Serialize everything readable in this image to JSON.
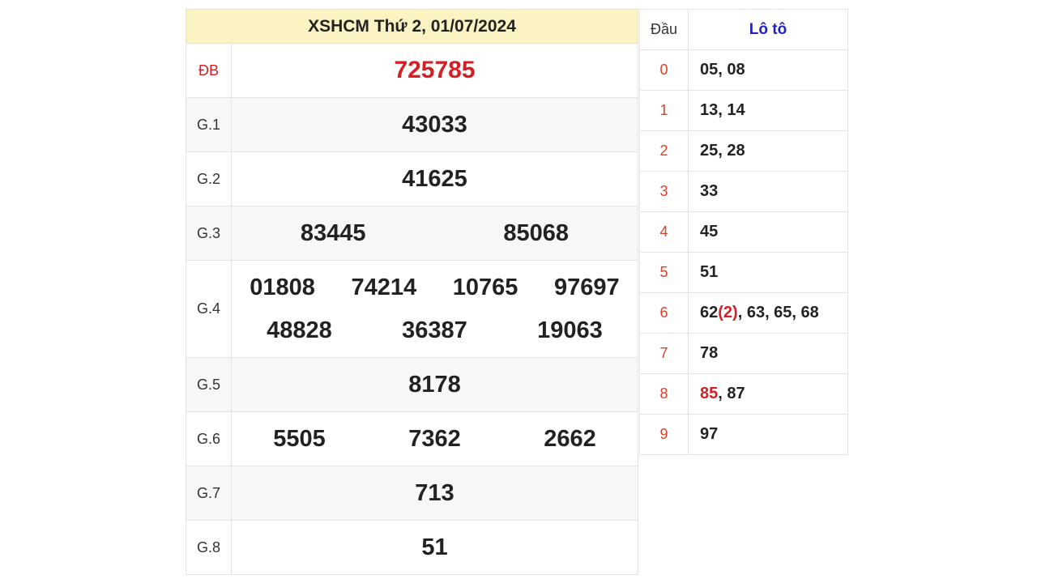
{
  "results": {
    "title": "XSHCM Thứ 2, 01/07/2024",
    "accent_color": "#d32027",
    "header_bg": "#fcf3c2",
    "prizes": [
      {
        "label": "ĐB",
        "numbers": [
          "725785"
        ]
      },
      {
        "label": "G.1",
        "numbers": [
          "43033"
        ]
      },
      {
        "label": "G.2",
        "numbers": [
          "41625"
        ]
      },
      {
        "label": "G.3",
        "numbers": [
          "83445",
          "85068"
        ]
      },
      {
        "label": "G.4",
        "numbers": [
          "01808",
          "74214",
          "10765",
          "97697",
          "48828",
          "36387",
          "19063"
        ]
      },
      {
        "label": "G.5",
        "numbers": [
          "8178"
        ]
      },
      {
        "label": "G.6",
        "numbers": [
          "5505",
          "7362",
          "2662"
        ]
      },
      {
        "label": "G.7",
        "numbers": [
          "713"
        ]
      },
      {
        "label": "G.8",
        "numbers": [
          "51"
        ]
      }
    ]
  },
  "loto": {
    "header_dau": "Đầu",
    "header_loto": "Lô tô",
    "rows": [
      {
        "dau": "0",
        "values": "05, 08"
      },
      {
        "dau": "1",
        "values": "13, 14"
      },
      {
        "dau": "2",
        "values": "25, 28"
      },
      {
        "dau": "3",
        "values": "33"
      },
      {
        "dau": "4",
        "values": "45"
      },
      {
        "dau": "5",
        "values": "51"
      },
      {
        "dau": "6",
        "values_first": "62",
        "values_highlight": "(2)",
        "values_rest": ", 63, 65, 68"
      },
      {
        "dau": "7",
        "values": "78"
      },
      {
        "dau": "8",
        "values_highlight": "85",
        "values_rest": ", 87"
      },
      {
        "dau": "9",
        "values": "97"
      }
    ]
  }
}
